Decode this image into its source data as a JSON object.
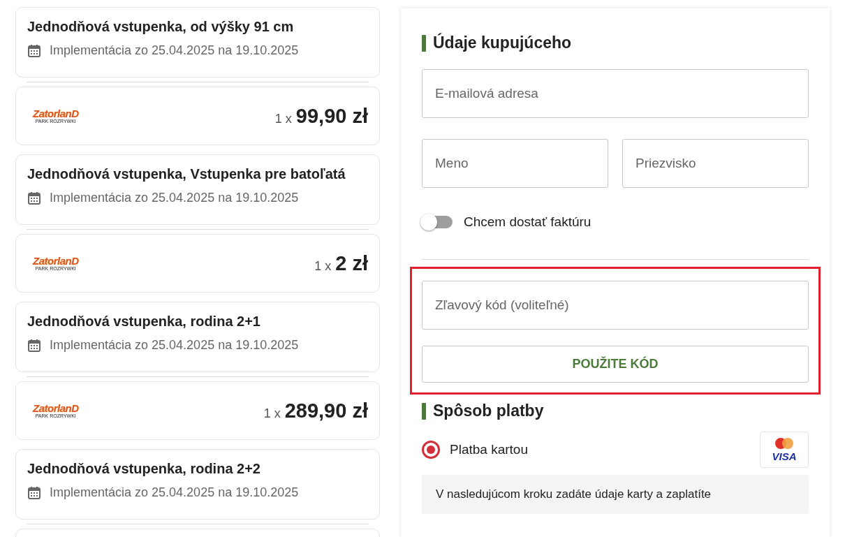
{
  "tickets": [
    {
      "title": "Jednodňová vstupenka, od výšky 91 cm",
      "validity": "Implementácia zo 25.04.2025 na 19.10.2025",
      "logo": {
        "name": "ZatorlanD",
        "tagline": "PARK ROZRYWKI"
      },
      "quantity": "1 x",
      "price": "99,90 zł"
    },
    {
      "title": "Jednodňová vstupenka, Vstupenka pre batoľatá",
      "validity": "Implementácia zo 25.04.2025 na 19.10.2025",
      "logo": {
        "name": "ZatorlanD",
        "tagline": "PARK ROZRYWKI"
      },
      "quantity": "1 x",
      "price": "2 zł"
    },
    {
      "title": "Jednodňová vstupenka, rodina 2+1",
      "validity": "Implementácia zo 25.04.2025 na 19.10.2025",
      "logo": {
        "name": "ZatorlanD",
        "tagline": "PARK ROZRYWKI"
      },
      "quantity": "1 x",
      "price": "289,90 zł"
    },
    {
      "title": "Jednodňová vstupenka, rodina 2+2",
      "validity": "Implementácia zo 25.04.2025 na 19.10.2025"
    }
  ],
  "buyer": {
    "title": "Údaje kupujúceho",
    "email": {
      "placeholder": "E-mailová adresa"
    },
    "first_name": {
      "placeholder": "Meno"
    },
    "last_name": {
      "placeholder": "Priezvisko"
    },
    "invoice_toggle": {
      "label": "Chcem dostať faktúru",
      "on": false
    }
  },
  "discount": {
    "highlighted": true,
    "placeholder": "Zľavový kód (voliteľné)",
    "button": "POUŽITE KÓD"
  },
  "payment": {
    "title": "Spôsob platby",
    "methods": [
      {
        "label": "Platba kartou",
        "selected": true,
        "card_brand": "VISA"
      }
    ],
    "info": "V nasledujúcom kroku zadáte údaje karty a zaplatíte"
  }
}
